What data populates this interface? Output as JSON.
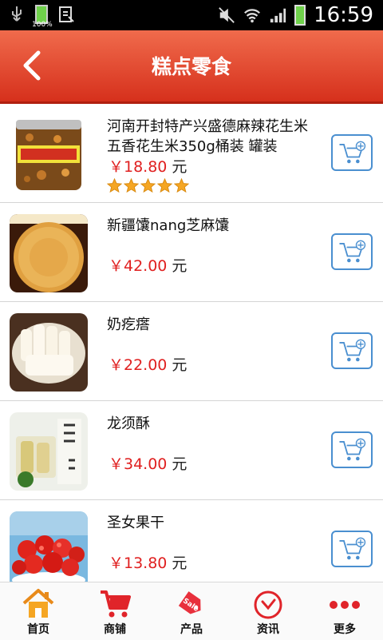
{
  "status": {
    "battery_pct": "100%",
    "time": "16:59"
  },
  "header": {
    "title": "糕点零食"
  },
  "products": [
    {
      "name": "河南开封特产兴盛德麻辣花生米五香花生米350g桶装 罐装",
      "price": "￥18.80",
      "unit": "元",
      "rating": 5
    },
    {
      "name": "新疆馕nang芝麻馕",
      "price": "￥42.00",
      "unit": "元"
    },
    {
      "name": "奶疙瘩",
      "price": "￥22.00",
      "unit": "元"
    },
    {
      "name": "龙须酥",
      "price": "￥34.00",
      "unit": "元"
    },
    {
      "name": "圣女果干",
      "price": "￥13.80",
      "unit": "元"
    }
  ],
  "tabs": [
    {
      "label": "首页",
      "icon": "home-icon"
    },
    {
      "label": "商铺",
      "icon": "shopping-cart-icon"
    },
    {
      "label": "产品",
      "icon": "sale-tag-icon"
    },
    {
      "label": "资讯",
      "icon": "clock-icon"
    },
    {
      "label": "更多",
      "icon": "more-dots-icon"
    }
  ],
  "colors": {
    "header": "#e04a2e",
    "price": "#e02020",
    "cart_border": "#4a8fd0",
    "star": "#f5a623"
  }
}
